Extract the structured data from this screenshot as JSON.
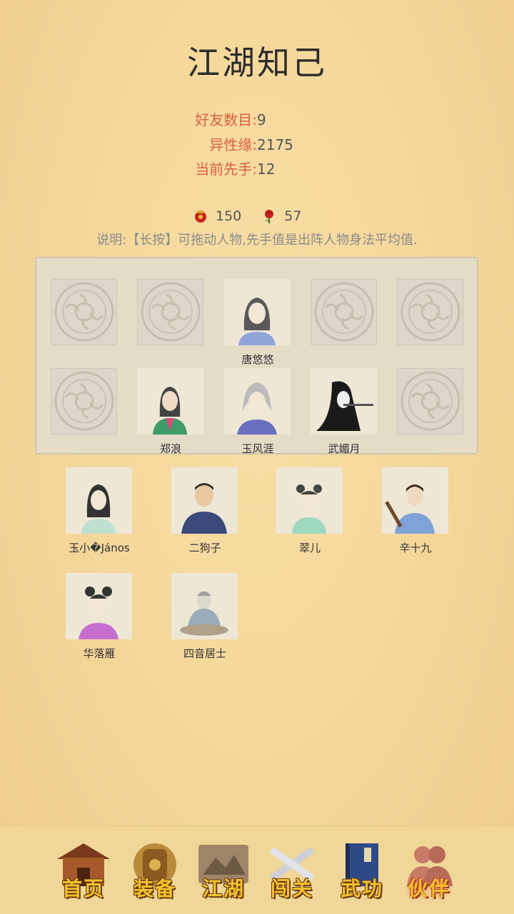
{
  "title": "江湖知己",
  "stats": [
    {
      "label": "好友数目:",
      "value": "9"
    },
    {
      "label": "异性缘:",
      "value": "2175"
    },
    {
      "label": "当前先手:",
      "value": "12"
    }
  ],
  "currency": [
    {
      "icon": "red-pouch-icon",
      "value": "150"
    },
    {
      "icon": "rose-icon",
      "value": "57"
    }
  ],
  "description": "说明:【长按】可拖动人物,先手值是出阵人物身法平均值.",
  "formation": {
    "row1": [
      "",
      "",
      "唐悠悠",
      "",
      ""
    ],
    "row2": [
      "",
      "郑浪",
      "玉风涯",
      "武媚月",
      ""
    ]
  },
  "bench": [
    "玉小�János",
    "二狗子",
    "翠儿",
    "辛十九",
    "华落雁",
    "四音居士"
  ],
  "nav": [
    {
      "label": "首页",
      "icon": "house-icon"
    },
    {
      "label": "装备",
      "icon": "armor-icon"
    },
    {
      "label": "江湖",
      "icon": "scroll-icon"
    },
    {
      "label": "闯关",
      "icon": "crossed-swords-icon"
    },
    {
      "label": "武功",
      "icon": "book-icon"
    },
    {
      "label": "伙伴",
      "icon": "partners-icon",
      "active": true
    }
  ],
  "colors": {
    "accent": "#d9603b",
    "background": "#f4d699",
    "nav_label": "#f2c22e"
  }
}
